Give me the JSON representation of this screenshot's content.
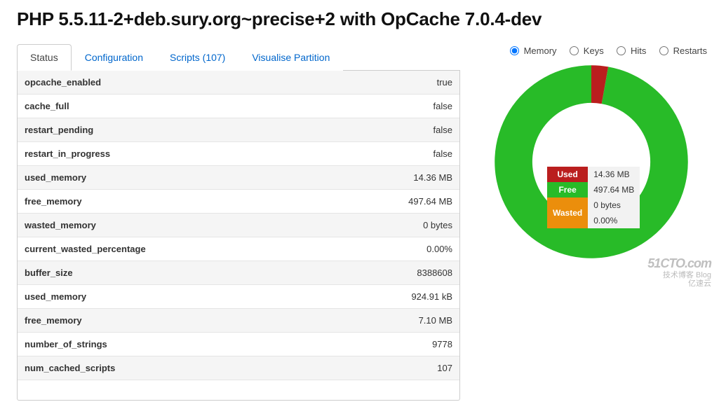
{
  "page_title": "PHP 5.5.11-2+deb.sury.org~precise+2 with OpCache 7.0.4-dev",
  "tabs": [
    {
      "id": "status",
      "label": "Status",
      "active": true
    },
    {
      "id": "config",
      "label": "Configuration",
      "active": false
    },
    {
      "id": "scripts",
      "label": "Scripts (107)",
      "active": false
    },
    {
      "id": "visualise",
      "label": "Visualise Partition",
      "active": false
    }
  ],
  "status_rows": [
    {
      "key": "opcache_enabled",
      "value": "true"
    },
    {
      "key": "cache_full",
      "value": "false"
    },
    {
      "key": "restart_pending",
      "value": "false"
    },
    {
      "key": "restart_in_progress",
      "value": "false"
    },
    {
      "key": "used_memory",
      "value": "14.36 MB"
    },
    {
      "key": "free_memory",
      "value": "497.64 MB"
    },
    {
      "key": "wasted_memory",
      "value": "0 bytes"
    },
    {
      "key": "current_wasted_percentage",
      "value": "0.00%"
    },
    {
      "key": "buffer_size",
      "value": "8388608"
    },
    {
      "key": "used_memory",
      "value": "924.91 kB"
    },
    {
      "key": "free_memory",
      "value": "7.10 MB"
    },
    {
      "key": "number_of_strings",
      "value": "9778"
    },
    {
      "key": "num_cached_scripts",
      "value": "107"
    }
  ],
  "chart_switch": {
    "options": [
      {
        "id": "memory",
        "label": "Memory",
        "checked": true
      },
      {
        "id": "keys",
        "label": "Keys",
        "checked": false
      },
      {
        "id": "hits",
        "label": "Hits",
        "checked": false
      },
      {
        "id": "restarts",
        "label": "Restarts",
        "checked": false
      }
    ]
  },
  "chart_data": {
    "type": "pie",
    "title": "Memory",
    "series": [
      {
        "name": "Used",
        "value_mb": 14.36,
        "display": "14.36 MB",
        "color": "#ba1e1e"
      },
      {
        "name": "Free",
        "value_mb": 497.64,
        "display": "497.64 MB",
        "color": "#28bb28"
      },
      {
        "name": "Wasted",
        "value_mb": 0,
        "display": "0 bytes",
        "color": "#eb8e0c",
        "extra": "0.00%"
      }
    ],
    "total_mb": 512.0
  },
  "watermark": {
    "brand": "51CTO.com",
    "tagline": "技术博客  Blog",
    "sub": "亿速云"
  }
}
